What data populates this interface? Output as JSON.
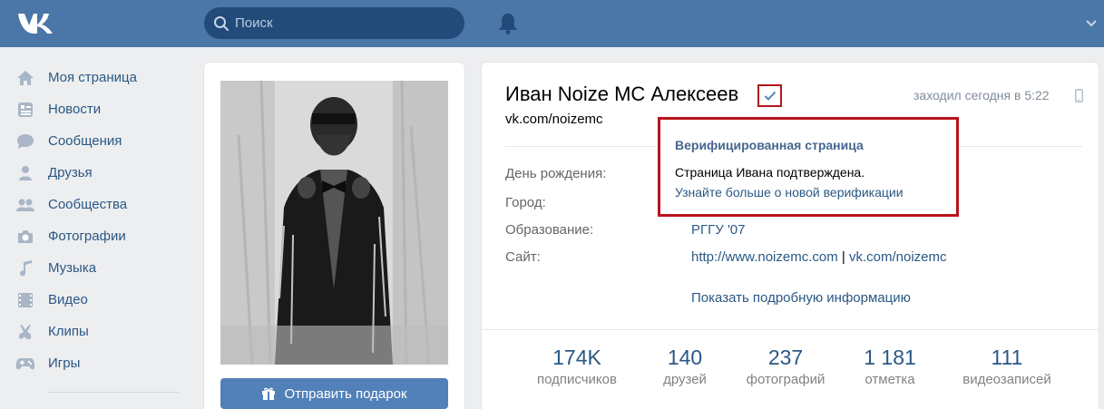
{
  "header": {
    "search_placeholder": "Поиск"
  },
  "sidebar": {
    "items": [
      {
        "label": "Моя страница",
        "icon": "home-icon"
      },
      {
        "label": "Новости",
        "icon": "news-icon"
      },
      {
        "label": "Сообщения",
        "icon": "messages-icon"
      },
      {
        "label": "Друзья",
        "icon": "friends-icon"
      },
      {
        "label": "Сообщества",
        "icon": "communities-icon"
      },
      {
        "label": "Фотографии",
        "icon": "camera-icon"
      },
      {
        "label": "Музыка",
        "icon": "music-icon"
      },
      {
        "label": "Видео",
        "icon": "video-icon"
      },
      {
        "label": "Клипы",
        "icon": "clips-icon"
      },
      {
        "label": "Игры",
        "icon": "gamepad-icon"
      }
    ]
  },
  "photo_card": {
    "gift_button": "Отправить подарок"
  },
  "profile": {
    "name": "Иван Noize MC Алексеев",
    "link": "vk.com/noizemc",
    "last_seen": "заходил сегодня в 5:22",
    "fields": {
      "birthday_label": "День рождения:",
      "city_label": "Город:",
      "education_label": "Образование:",
      "education_value": "РГГУ '07",
      "site_label": "Сайт:",
      "site_value_1": "http://www.noizemc.com",
      "site_separator": "|",
      "site_value_2": "vk.com/noizemc"
    },
    "more_info": "Показать подробную информацию",
    "counters": [
      {
        "num": "174K",
        "label": "подписчиков"
      },
      {
        "num": "140",
        "label": "друзей"
      },
      {
        "num": "237",
        "label": "фотографий"
      },
      {
        "num": "1 181",
        "label": "отметка"
      },
      {
        "num": "111",
        "label": "видеозаписей"
      }
    ]
  },
  "tooltip": {
    "title": "Верифицированная страница",
    "text": "Страница Ивана подтверждена.",
    "link": "Узнайте больше о новой верификации"
  },
  "colors": {
    "header": "#4a76a8",
    "link": "#2a5885",
    "highlight": "#b8141c",
    "button": "#5181b8"
  }
}
